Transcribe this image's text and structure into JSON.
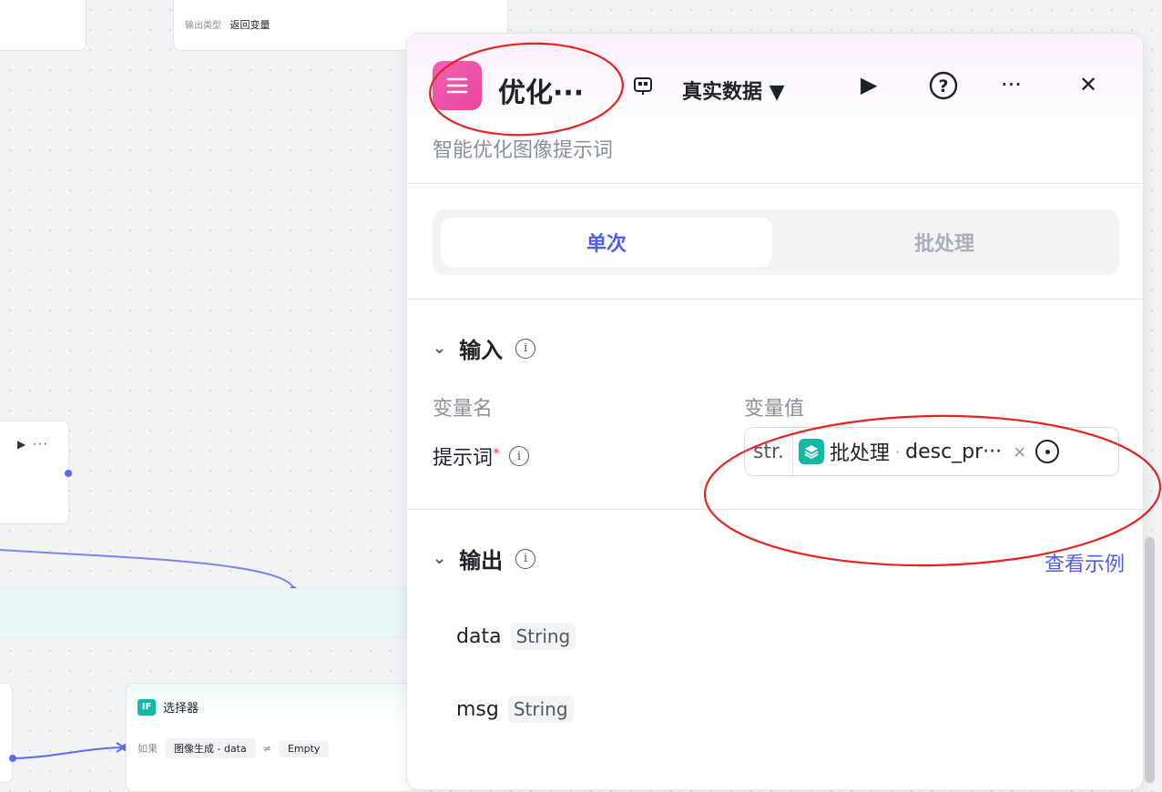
{
  "canvas": {
    "output_node": {
      "label": "输出类型",
      "value": "返回变量"
    },
    "mid_node": {
      "run": "▶",
      "more": "···"
    },
    "selector_node": {
      "badge": "IF",
      "title": "选择器",
      "condition_label": "如果",
      "left_operand": "图像生成 - data",
      "operator": "≠",
      "right_operand": "Empty"
    }
  },
  "panel": {
    "title": "优化···",
    "description": "智能优化图像提示词",
    "data_source": "真实数据 ▼",
    "icons": [
      "node-type-icon",
      "play-icon",
      "help-icon",
      "more-icon",
      "close-icon"
    ],
    "header_glyphs": {
      "play": "▶",
      "help": "?",
      "more": "···",
      "close": "✕"
    },
    "tabs": [
      {
        "label": "单次",
        "active": true
      },
      {
        "label": "批处理",
        "active": false
      }
    ],
    "input": {
      "title": "输入",
      "col_name": "变量名",
      "col_value": "变量值",
      "var_name": "提示词",
      "required": "*",
      "type_prefix": "str.",
      "ref_source": "批处理",
      "ref_sep": "·",
      "ref_var": "desc_pr···",
      "clear": "×"
    },
    "output": {
      "title": "输出",
      "example_link": "查看示例",
      "fields": [
        {
          "name": "data",
          "type": "String"
        },
        {
          "name": "msg",
          "type": "String"
        }
      ]
    },
    "accent_color": "#4e5cf0",
    "icon_color": "#e8459c"
  }
}
